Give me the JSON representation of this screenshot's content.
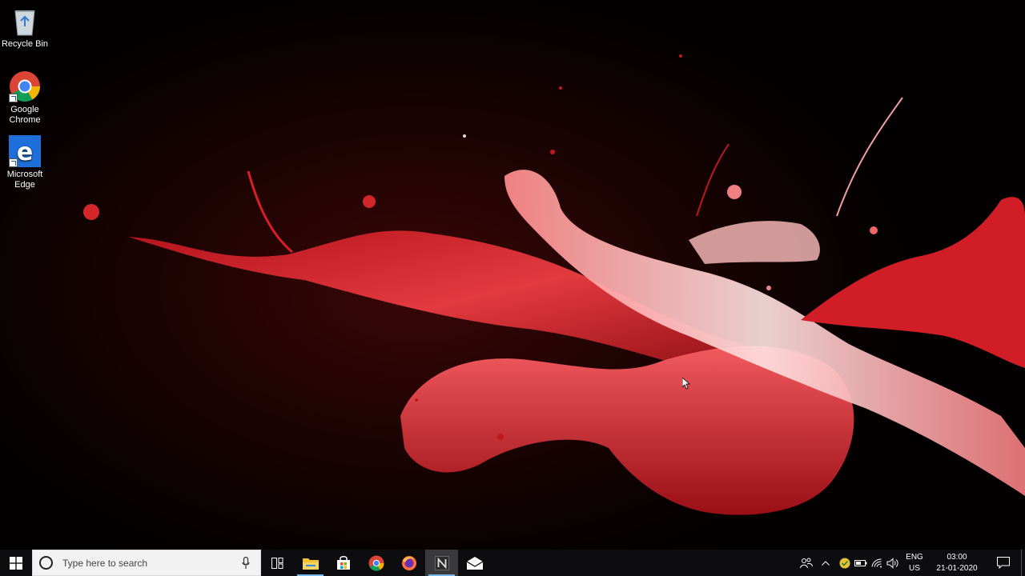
{
  "desktop": {
    "icons": [
      {
        "label": "Recycle Bin",
        "icon": "recycle-bin-icon"
      },
      {
        "label": "Google\nChrome",
        "icon": "chrome-icon"
      },
      {
        "label": "Microsoft\nEdge",
        "icon": "edge-icon"
      }
    ]
  },
  "taskbar": {
    "search_placeholder": "Type here to search",
    "apps": [
      {
        "icon": "task-view-icon"
      },
      {
        "icon": "file-explorer-icon"
      },
      {
        "icon": "microsoft-store-icon"
      },
      {
        "icon": "chrome-icon"
      },
      {
        "icon": "firefox-icon"
      },
      {
        "icon": "notepad-n-icon"
      },
      {
        "icon": "mail-icon"
      }
    ],
    "tray": {
      "language_top": "ENG",
      "language_bottom": "US",
      "time": "03:00",
      "date": "21-01-2020"
    }
  },
  "colors": {
    "taskbar_bg": "#0d0d0f",
    "accent": "#76b9ed",
    "splash_red": "#e0242b"
  }
}
